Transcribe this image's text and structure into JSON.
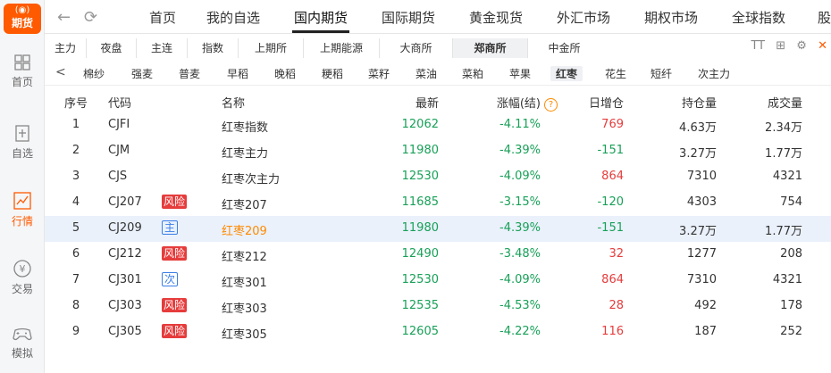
{
  "app": {
    "logo_text": "期货",
    "logo_mark": "(◉)"
  },
  "sidebar": {
    "items": [
      {
        "label": "首页",
        "icon": "grid-icon"
      },
      {
        "label": "自选",
        "icon": "plus-box-icon"
      },
      {
        "label": "行情",
        "icon": "chart-icon",
        "active": true
      },
      {
        "label": "交易",
        "icon": "yuan-circle-icon"
      },
      {
        "label": "模拟",
        "icon": "gamepad-icon"
      }
    ]
  },
  "topnav": {
    "back": "←",
    "refresh": "⟳",
    "links": [
      "首页",
      "我的自选",
      "国内期货",
      "国际期货",
      "黄金现货",
      "外汇市场",
      "期权市场",
      "全球指数",
      "股"
    ],
    "active": "国内期货"
  },
  "exchange_tabs": {
    "tabs": [
      "主力",
      "夜盘",
      "主连",
      "指数",
      "上期所",
      "上期能源",
      "大商所",
      "郑商所",
      "中金所"
    ],
    "active": "郑商所",
    "tools": [
      "TT",
      "⊞",
      "⚙",
      "✕"
    ]
  },
  "product_tabs": {
    "back": "<",
    "items": [
      "棉纱",
      "强麦",
      "普麦",
      "早稻",
      "晚稻",
      "粳稻",
      "菜籽",
      "菜油",
      "菜粕",
      "苹果",
      "红枣",
      "花生",
      "短纤",
      "次主力"
    ],
    "active": "红枣"
  },
  "table": {
    "headers": {
      "idx": "序号",
      "code": "代码",
      "name": "名称",
      "latest": "最新",
      "change": "涨幅(结)",
      "help": "?",
      "daily": "日增仓",
      "hold": "持仓量",
      "vol": "成交量"
    },
    "rows": [
      {
        "idx": "1",
        "code": "CJFI",
        "badge": "",
        "badge_type": "",
        "name": "红枣指数",
        "latest": "12062",
        "change": "-4.11%",
        "daily": "769",
        "daily_dir": "up",
        "hold": "4.63万",
        "vol": "2.34万"
      },
      {
        "idx": "2",
        "code": "CJM",
        "badge": "",
        "badge_type": "",
        "name": "红枣主力",
        "latest": "11980",
        "change": "-4.39%",
        "daily": "-151",
        "daily_dir": "down",
        "hold": "3.27万",
        "vol": "1.77万"
      },
      {
        "idx": "3",
        "code": "CJS",
        "badge": "",
        "badge_type": "",
        "name": "红枣次主力",
        "latest": "12530",
        "change": "-4.09%",
        "daily": "864",
        "daily_dir": "up",
        "hold": "7310",
        "vol": "4321"
      },
      {
        "idx": "4",
        "code": "CJ207",
        "badge": "风险",
        "badge_type": "risk",
        "name": "红枣207",
        "latest": "11685",
        "change": "-3.15%",
        "daily": "-120",
        "daily_dir": "down",
        "hold": "4303",
        "vol": "754"
      },
      {
        "idx": "5",
        "code": "CJ209",
        "badge": "主",
        "badge_type": "main",
        "name": "红枣209",
        "latest": "11980",
        "change": "-4.39%",
        "daily": "-151",
        "daily_dir": "down",
        "hold": "3.27万",
        "vol": "1.77万",
        "selected": true
      },
      {
        "idx": "6",
        "code": "CJ212",
        "badge": "风险",
        "badge_type": "risk",
        "name": "红枣212",
        "latest": "12490",
        "change": "-3.48%",
        "daily": "32",
        "daily_dir": "up",
        "hold": "1277",
        "vol": "208"
      },
      {
        "idx": "7",
        "code": "CJ301",
        "badge": "次",
        "badge_type": "sub",
        "name": "红枣301",
        "latest": "12530",
        "change": "-4.09%",
        "daily": "864",
        "daily_dir": "up",
        "hold": "7310",
        "vol": "4321"
      },
      {
        "idx": "8",
        "code": "CJ303",
        "badge": "风险",
        "badge_type": "risk",
        "name": "红枣303",
        "latest": "12535",
        "change": "-4.53%",
        "daily": "28",
        "daily_dir": "up",
        "hold": "492",
        "vol": "178"
      },
      {
        "idx": "9",
        "code": "CJ305",
        "badge": "风险",
        "badge_type": "risk",
        "name": "红枣305",
        "latest": "12605",
        "change": "-4.22%",
        "daily": "116",
        "daily_dir": "up",
        "hold": "187",
        "vol": "252"
      }
    ]
  },
  "colors": {
    "accent": "#ff5a00",
    "down": "#18a058",
    "up": "#e63c3c",
    "badge_blue": "#3a7ee8",
    "selected_row": "#eaf1fb"
  }
}
